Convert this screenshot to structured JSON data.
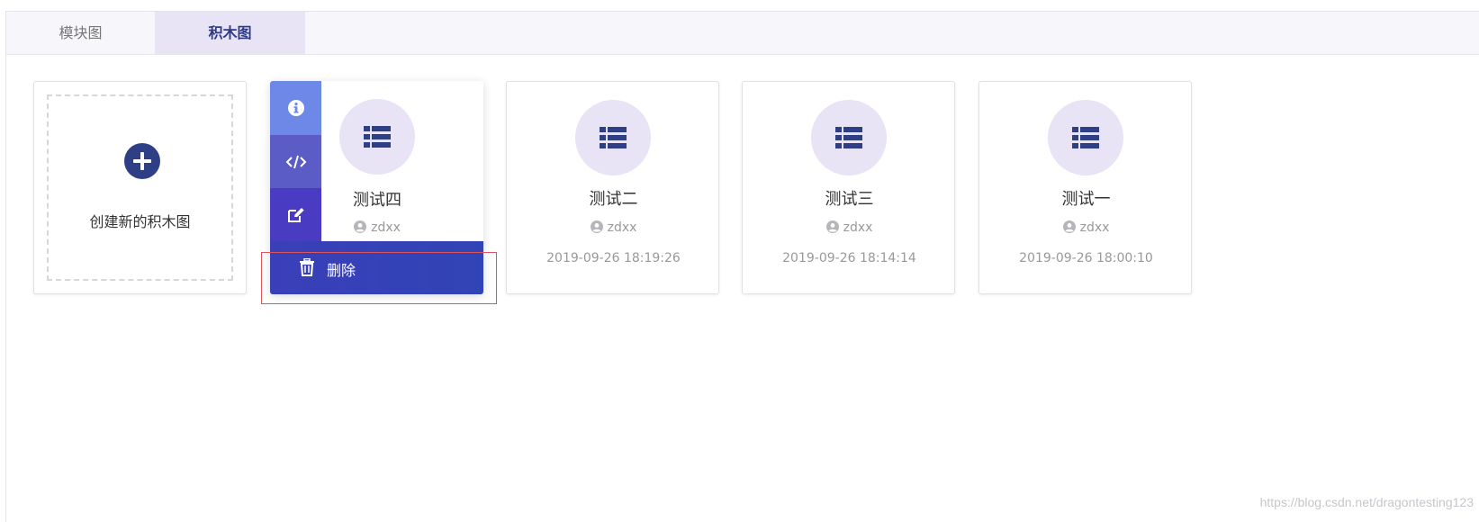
{
  "tabs": [
    {
      "label": "模块图"
    },
    {
      "label": "积木图"
    }
  ],
  "create_card": {
    "label": "创建新的积木图"
  },
  "hover_card": {
    "title": "测试四",
    "user": "zdxx",
    "actions": [
      "info-icon",
      "code-icon",
      "edit-icon"
    ],
    "delete_label": "删除"
  },
  "cards": [
    {
      "title": "测试二",
      "user": "zdxx",
      "date": "2019-09-26 18:19:26"
    },
    {
      "title": "测试三",
      "user": "zdxx",
      "date": "2019-09-26 18:14:14"
    },
    {
      "title": "测试一",
      "user": "zdxx",
      "date": "2019-09-26 18:00:10"
    }
  ],
  "watermark": "https://blog.csdn.net/dragontesting123",
  "colors": {
    "accent": "#2f3f86",
    "icon_bg": "#e8e3f5",
    "delete_bg": "#3a3fb8",
    "highlight_box": "#e0555a"
  }
}
